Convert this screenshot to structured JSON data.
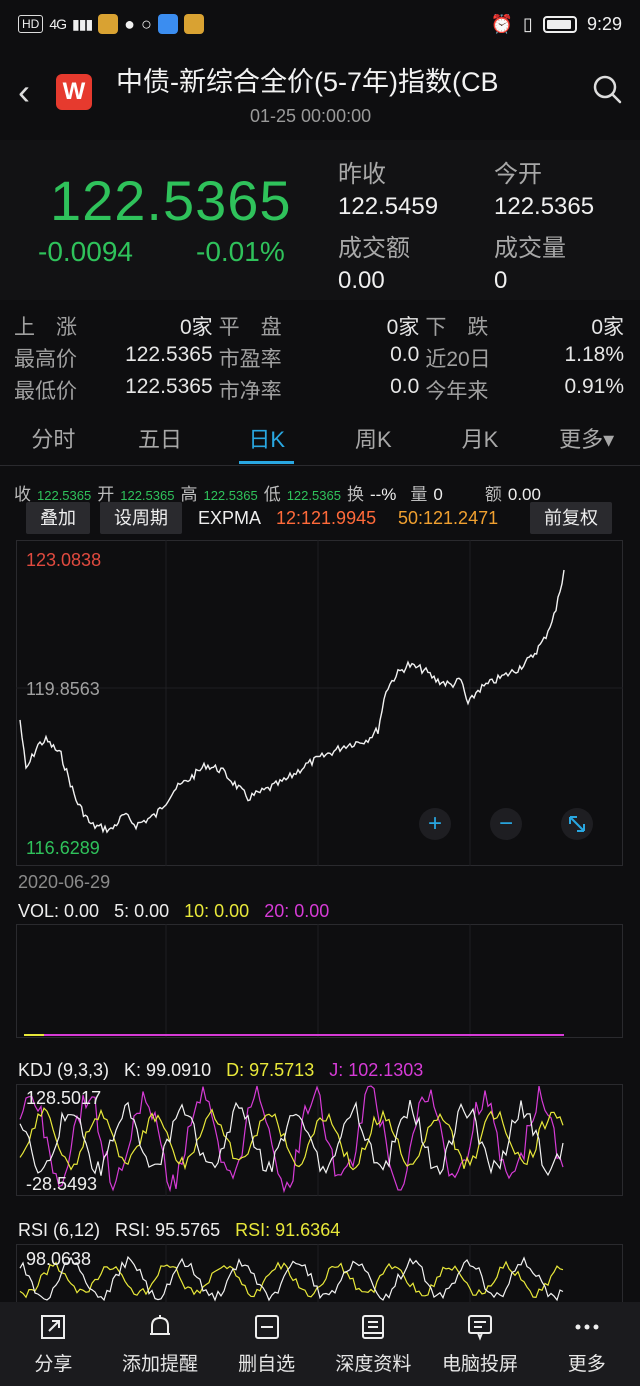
{
  "status": {
    "net": "HD",
    "sig": "4G",
    "time": "9:29"
  },
  "header": {
    "title": "中债-新综合全价(5-7年)指数(CB",
    "subtitle": "01-25 00:00:00",
    "logo": "W"
  },
  "quote": {
    "price": "122.5365",
    "change": "-0.0094",
    "change_pct": "-0.01%",
    "prev_close_label": "昨收",
    "prev_close": "122.5459",
    "open_label": "今开",
    "open": "122.5365",
    "amount_label": "成交额",
    "amount": "0.00",
    "volume_label": "成交量",
    "volume": "0"
  },
  "stats": [
    [
      {
        "k": "上　涨",
        "v": "0家"
      },
      {
        "k": "平　盘",
        "v": "0家"
      },
      {
        "k": "下　跌",
        "v": "0家"
      }
    ],
    [
      {
        "k": "最高价",
        "v": "122.5365"
      },
      {
        "k": "市盈率",
        "v": "0.0"
      },
      {
        "k": "近20日",
        "v": "1.18%"
      }
    ],
    [
      {
        "k": "最低价",
        "v": "122.5365"
      },
      {
        "k": "市净率",
        "v": "0.0"
      },
      {
        "k": "今年来",
        "v": "0.91%"
      }
    ]
  ],
  "tabs": [
    "分时",
    "五日",
    "日K",
    "周K",
    "月K",
    "更多▾"
  ],
  "kinfo": {
    "close_l": "收",
    "close_v": "122.5365",
    "open_l": "开",
    "open_v": "122.5365",
    "high_l": "高",
    "high_v": "122.5365",
    "low_l": "低",
    "low_v": "122.5365",
    "turn_l": "换",
    "turn_v": "--%",
    "vol_l": "量",
    "vol_v": "0",
    "amt_l": "额",
    "amt_v": "0.00"
  },
  "tools": {
    "overlay": "叠加",
    "period": "设周期",
    "expma": "EXPMA",
    "e12": "12:121.9945",
    "e50": "50:121.2471",
    "adj": "前复权"
  },
  "colors": {
    "up": "#e04a3f",
    "down": "#2fc25b",
    "accent": "#29a7e1",
    "yellow": "#e8e83a",
    "magenta": "#d63bd6",
    "orange": "#f0a030"
  },
  "main_chart": {
    "max_label": "123.0838",
    "mid_label": "119.8563",
    "min_label": "116.6289",
    "start_date": "2020-06-29"
  },
  "vol": {
    "label": "VOL: 0.00",
    "v5": "5: 0.00",
    "v10": "10: 0.00",
    "v20": "20: 0.00"
  },
  "kdj": {
    "label": "KDJ (9,3,3)",
    "k": "K: 99.0910",
    "d": "D: 97.5713",
    "j": "J: 102.1303",
    "max": "128.5017",
    "min": "-28.5493"
  },
  "rsi": {
    "label": "RSI (6,12)",
    "r1": "RSI: 95.5765",
    "r2": "RSI: 91.6364",
    "max": "98.0638"
  },
  "bottom_nav": [
    "分享",
    "添加提醒",
    "删自选",
    "深度资料",
    "电脑投屏",
    "更多"
  ]
}
